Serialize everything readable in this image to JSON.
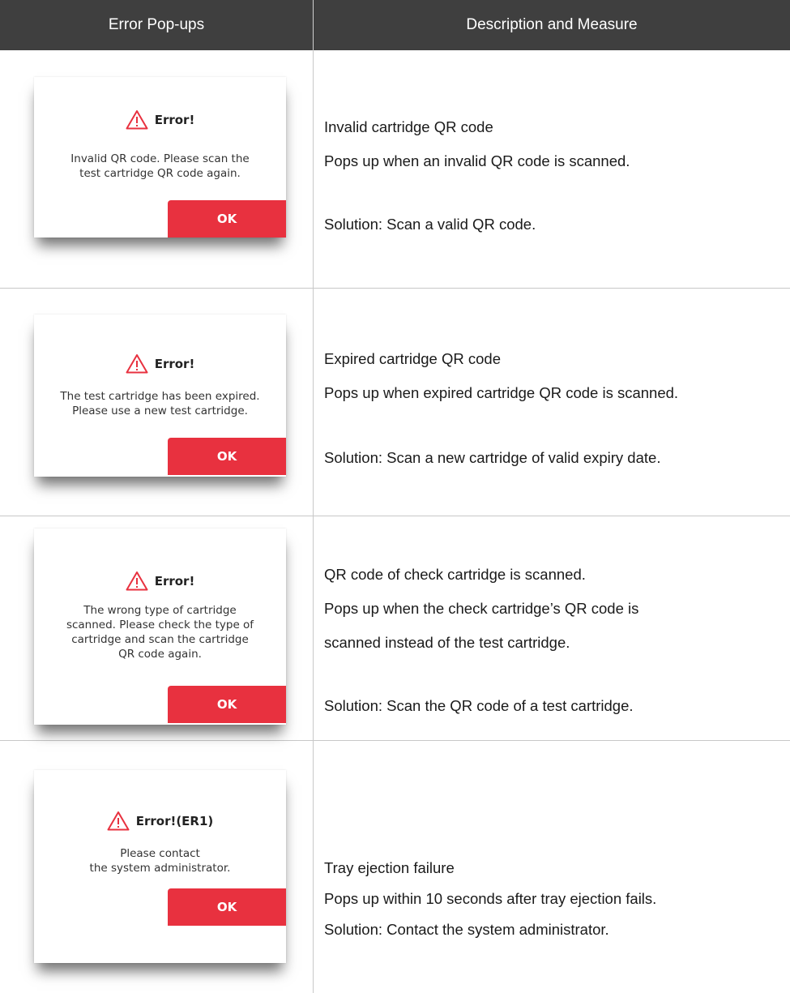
{
  "header": {
    "col1": "Error Pop-ups",
    "col2": "Description and Measure"
  },
  "colors": {
    "header_bg": "#3f3f3f",
    "ok_button": "#e8313f",
    "warning_icon": "#e8313f"
  },
  "rows": [
    {
      "popup": {
        "icon": "warning-triangle-icon",
        "title": "Error!",
        "message": [
          "Invalid QR code. Please scan the",
          "test cartridge QR code again."
        ],
        "ok_label": "OK"
      },
      "description": {
        "lines": [
          "Invalid cartridge QR code",
          "Pops up when an invalid QR code is scanned."
        ],
        "solution": "Solution: Scan a valid QR code."
      }
    },
    {
      "popup": {
        "icon": "warning-triangle-icon",
        "title": "Error!",
        "message": [
          "The test cartridge has been expired.",
          "Please use a new test cartridge."
        ],
        "ok_label": "OK"
      },
      "description": {
        "lines": [
          "Expired cartridge QR code",
          "Pops up when expired cartridge QR code is scanned."
        ],
        "solution": "Solution: Scan a new cartridge of valid expiry date."
      }
    },
    {
      "popup": {
        "icon": "warning-triangle-icon",
        "title": "Error!",
        "message": [
          "The wrong type of cartridge",
          "scanned. Please check the type of",
          "cartridge and scan the cartridge",
          "QR code again."
        ],
        "ok_label": "OK"
      },
      "description": {
        "lines": [
          "QR code of check cartridge is scanned.",
          "Pops up when the check cartridge’s QR code is",
          "scanned instead of the test cartridge."
        ],
        "solution": "Solution: Scan the QR code of a test cartridge."
      }
    },
    {
      "popup": {
        "icon": "warning-triangle-icon",
        "title": "Error!(ER1)",
        "message": [
          "Please contact",
          "the system administrator."
        ],
        "ok_label": "OK"
      },
      "description": {
        "lines": [
          "Tray ejection failure",
          "Pops up within 10 seconds after tray ejection fails.",
          "Solution: Contact the system administrator."
        ],
        "solution": ""
      }
    }
  ]
}
